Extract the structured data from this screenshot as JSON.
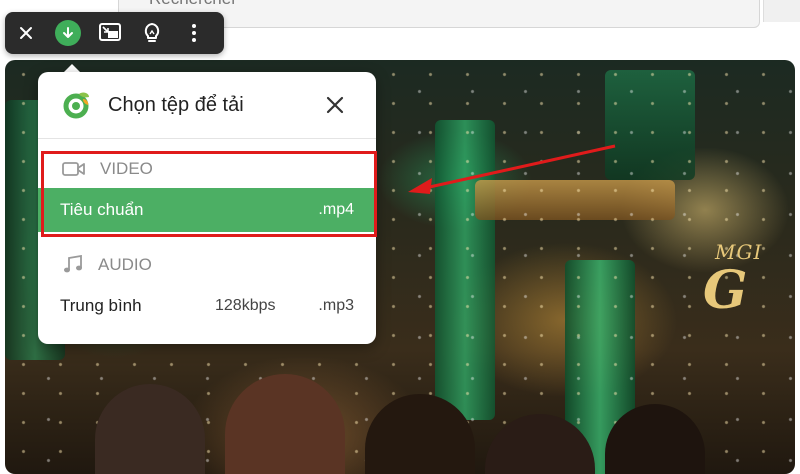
{
  "browser": {
    "search_placeholder": "Rechercher"
  },
  "toolbar": {
    "buttons": [
      {
        "name": "close",
        "icon": "close-icon"
      },
      {
        "name": "download",
        "icon": "download-icon",
        "color": "#3fae5a"
      },
      {
        "name": "picture-in-picture",
        "icon": "pip-icon"
      },
      {
        "name": "tips",
        "icon": "lightbulb-icon"
      },
      {
        "name": "more",
        "icon": "more-vertical-icon"
      }
    ]
  },
  "popup": {
    "title": "Chọn tệp để tải",
    "brand_icon": "coccoc-logo-icon",
    "brand_color": "#4caf50",
    "sections": {
      "video": {
        "label": "VIDEO",
        "icon": "video-camera-icon",
        "items": [
          {
            "name": "Tiêu chuẩn",
            "ext": ".mp4",
            "selected": true
          }
        ]
      },
      "audio": {
        "label": "AUDIO",
        "icon": "music-note-icon",
        "items": [
          {
            "name": "Trung bình",
            "bitrate": "128kbps",
            "ext": ".mp3",
            "selected": false
          }
        ]
      }
    },
    "selected_color": "#4caf64"
  },
  "video": {
    "watermark": "MGI"
  },
  "annotation": {
    "highlight_color": "#e01b1b"
  }
}
